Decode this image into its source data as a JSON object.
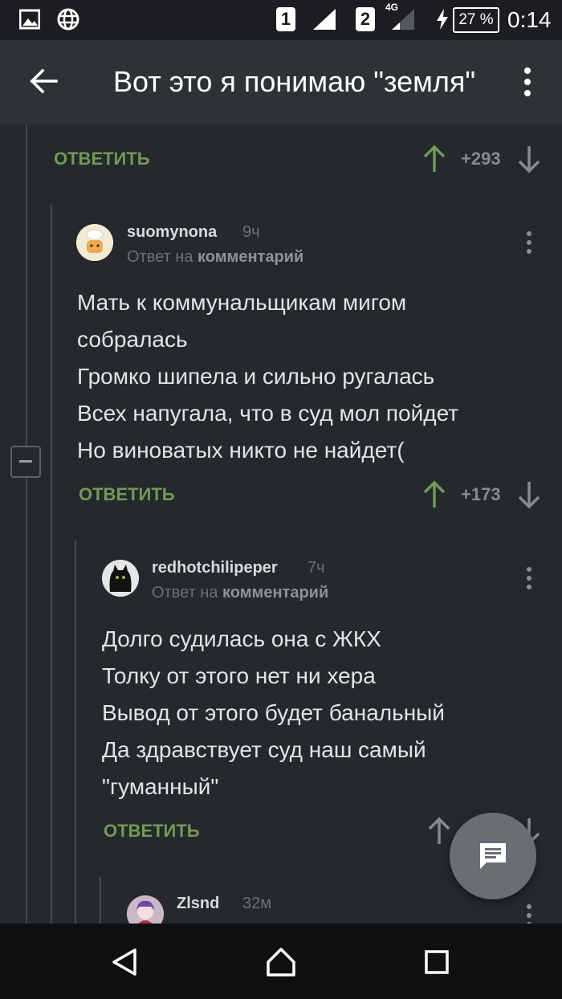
{
  "status_bar": {
    "sim1": "1",
    "sim2": "2",
    "network": "4G",
    "battery": "27 %",
    "time": "0:14"
  },
  "app_bar": {
    "title": "Вот это я понимаю \"земля\""
  },
  "top_actions": {
    "reply_label": "ОТВЕТИТЬ",
    "score": "+293"
  },
  "comments": [
    {
      "username": "suomynona",
      "time": "9ч",
      "reply_to_prefix": "Ответ на",
      "reply_to_target": "комментарий",
      "lines": [
        "Мать к коммунальщикам мигом",
        "собралась",
        "Громко шипела и сильно ругалась",
        "Всех напугала, что в суд мол пойдет",
        "Но виноватых никто не найдет("
      ],
      "reply_label": "ОТВЕТИТЬ",
      "score": "+173"
    },
    {
      "username": "redhotchilipeper",
      "time": "7ч",
      "reply_to_prefix": "Ответ на",
      "reply_to_target": "комментарий",
      "lines": [
        "Долго судилась она с ЖКХ",
        "Толку от этого нет ни хера",
        "Вывод от этого будет банальный",
        "Да здравствует суд наш самый",
        "\"гуманный\""
      ],
      "reply_label": "ОТВЕТИТЬ"
    },
    {
      "username": "Zlsnd",
      "time": "32м"
    }
  ],
  "colors": {
    "background": "#25282c",
    "app_bar": "#2e3236",
    "accent_green": "#6f9b55",
    "fab": "#6a6e73"
  }
}
